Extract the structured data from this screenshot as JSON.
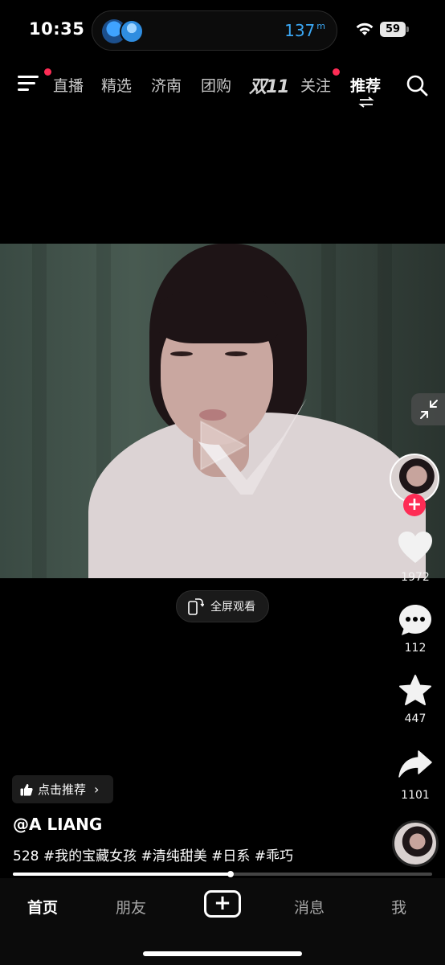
{
  "status_bar": {
    "time": "10:35",
    "distance": "137",
    "distance_unit": "m",
    "battery": "59"
  },
  "top_nav": {
    "tabs": [
      "直播",
      "精选",
      "济南",
      "团购",
      "双11",
      "关注",
      "推荐"
    ],
    "active_tab": "推荐",
    "icons": [
      "menu-icon",
      "swap-icon",
      "search-icon"
    ]
  },
  "video": {
    "fullscreen_label": "全屏观看"
  },
  "right_rail": {
    "like_count": "1972",
    "comment_count": "112",
    "favorite_count": "447",
    "share_count": "1101",
    "follow_symbol": "+"
  },
  "caption": {
    "recommend_label": "点击推荐",
    "recommend_arrow": "›",
    "author": "@A LIANG",
    "description": "528 #我的宝藏女孩 #清纯甜美 #日系 #乖巧"
  },
  "progress": 0.52,
  "bottom_tabs": {
    "home": "首页",
    "friends": "朋友",
    "add": "+",
    "messages": "消息",
    "me": "我"
  },
  "colors": {
    "accent": "#fe2c55",
    "distance": "#3ba8f5",
    "background": "#000000"
  }
}
